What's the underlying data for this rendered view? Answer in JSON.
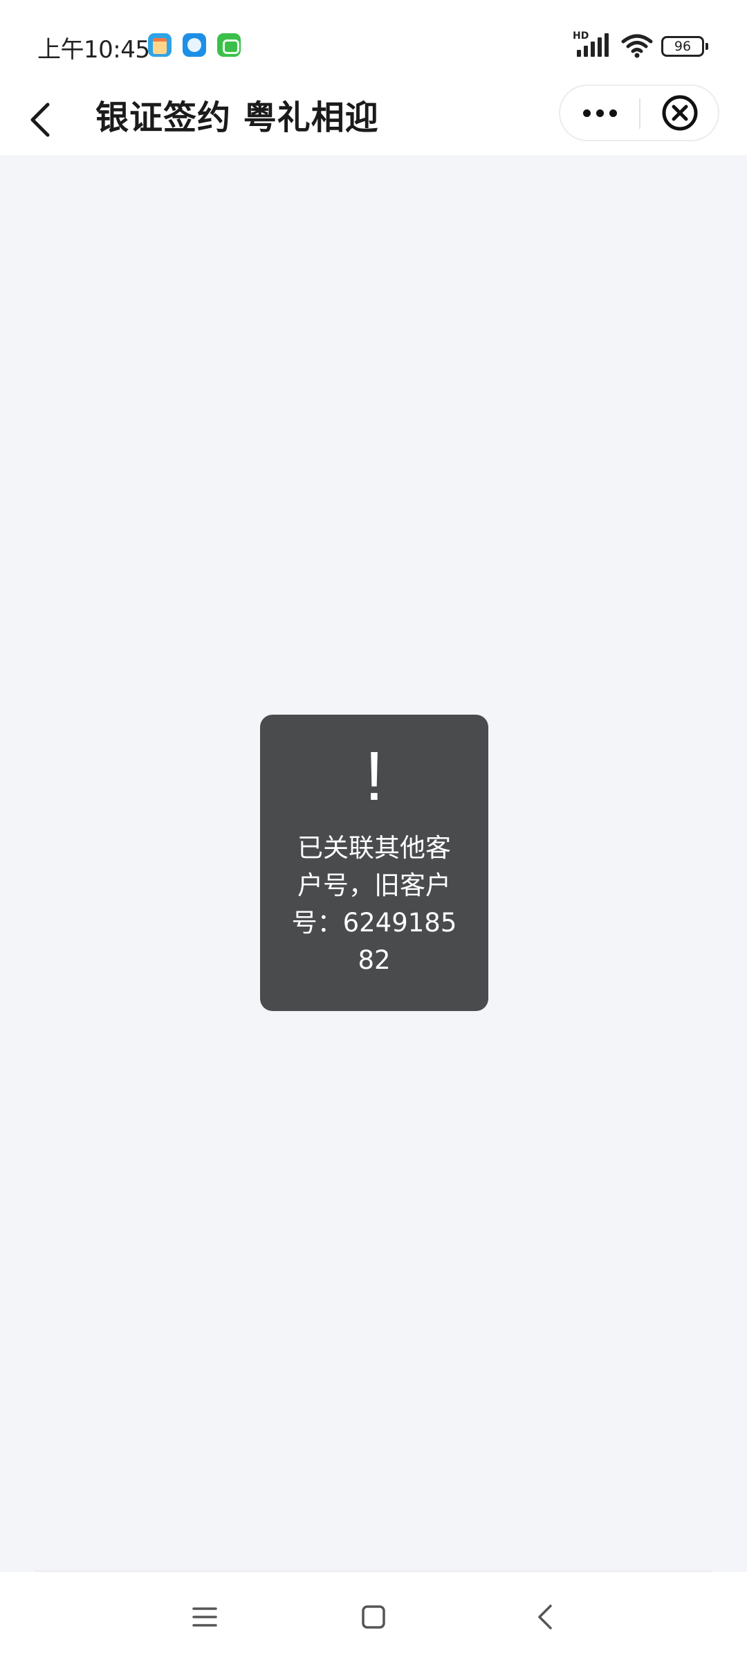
{
  "status_bar": {
    "time": "上午10:45",
    "network_label": "HD",
    "battery_level": "96",
    "app_icons": [
      "calendar-icon",
      "messenger-icon",
      "robot-app-icon"
    ]
  },
  "nav_bar": {
    "title": "银证签约 粤礼相迎",
    "back_icon": "chevron-left-icon",
    "more_icon": "more-dots-icon",
    "close_icon": "close-circle-icon"
  },
  "toast": {
    "icon": "!",
    "message": "已关联其他客户号，旧客户号：624918582"
  },
  "system_nav": {
    "menu_icon": "menu-icon",
    "home_icon": "home-square-icon",
    "back_icon": "back-chevron-icon"
  },
  "colors": {
    "page_background": "#f4f5f9",
    "toast_background": "#4a4b4d",
    "bar_background": "#ffffff"
  }
}
